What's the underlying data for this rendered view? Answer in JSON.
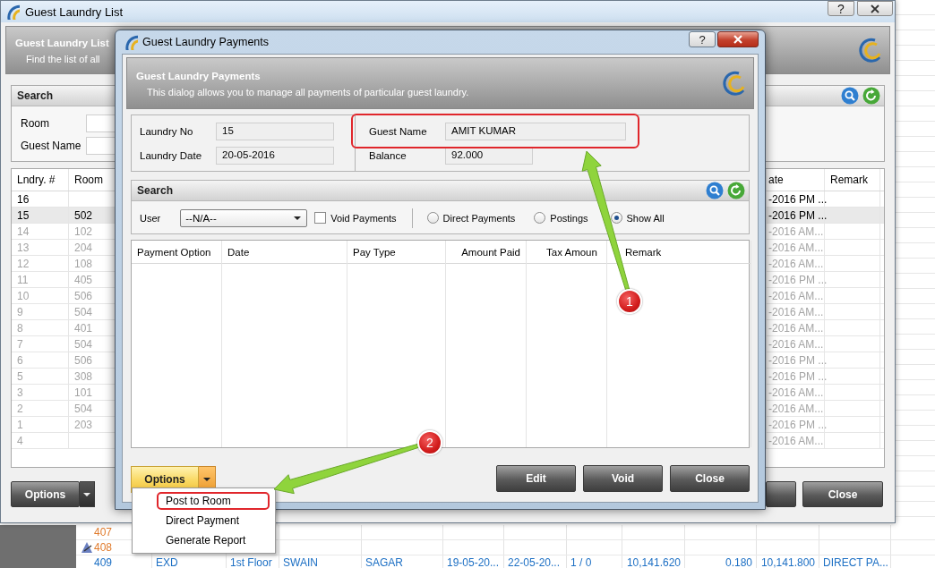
{
  "background_grid": {
    "rows": [
      {
        "cells": [
          "407"
        ],
        "color": "#e07b2c",
        "marked": false
      },
      {
        "cells": [
          "408"
        ],
        "color": "#e07b2c",
        "marked": true
      },
      {
        "cells": [
          "409",
          "EXD",
          "1st Floor",
          "SWAIN",
          "SAGAR",
          "19-05-20...",
          "22-05-20...",
          "1 / 0",
          "10,141.620",
          "0.180",
          "10,141.800",
          "DIRECT PA..."
        ],
        "color": "#1c6fc4",
        "marked": false
      }
    ]
  },
  "list_window": {
    "title": "Guest Laundry List",
    "help_button": "?",
    "header": {
      "title": "Guest Laundry List",
      "subtitle": "Find the list of all"
    },
    "search": {
      "title": "Search",
      "fields": [
        {
          "label": "Room"
        },
        {
          "label": "Guest Name"
        }
      ]
    },
    "table": {
      "columns": [
        "Lndry. #",
        "Room",
        "ate",
        "Remark"
      ],
      "rows": [
        {
          "cells": [
            "16",
            "",
            "-2016 PM ...",
            ""
          ],
          "selected": false,
          "dimmed": false
        },
        {
          "cells": [
            "15",
            "502",
            "-2016 PM ...",
            ""
          ],
          "selected": true,
          "dimmed": false
        },
        {
          "cells": [
            "14",
            "102",
            "-2016 AM...",
            ""
          ],
          "selected": false,
          "dimmed": true
        },
        {
          "cells": [
            "13",
            "204",
            "-2016 AM...",
            ""
          ],
          "selected": false,
          "dimmed": true
        },
        {
          "cells": [
            "12",
            "108",
            "-2016 AM...",
            ""
          ],
          "selected": false,
          "dimmed": true
        },
        {
          "cells": [
            "11",
            "405",
            "-2016 PM ...",
            ""
          ],
          "selected": false,
          "dimmed": true
        },
        {
          "cells": [
            "10",
            "506",
            "-2016 AM...",
            ""
          ],
          "selected": false,
          "dimmed": true
        },
        {
          "cells": [
            "9",
            "504",
            "-2016 AM...",
            ""
          ],
          "selected": false,
          "dimmed": true
        },
        {
          "cells": [
            "8",
            "401",
            "-2016 AM...",
            ""
          ],
          "selected": false,
          "dimmed": true
        },
        {
          "cells": [
            "7",
            "504",
            "-2016 AM...",
            ""
          ],
          "selected": false,
          "dimmed": true
        },
        {
          "cells": [
            "6",
            "506",
            "-2016 PM ...",
            ""
          ],
          "selected": false,
          "dimmed": true
        },
        {
          "cells": [
            "5",
            "308",
            "-2016 PM ...",
            ""
          ],
          "selected": false,
          "dimmed": true
        },
        {
          "cells": [
            "3",
            "101",
            "-2016 AM...",
            ""
          ],
          "selected": false,
          "dimmed": true
        },
        {
          "cells": [
            "2",
            "504",
            "-2016 AM...",
            ""
          ],
          "selected": false,
          "dimmed": true
        },
        {
          "cells": [
            "1",
            "203",
            "-2016 PM ...",
            ""
          ],
          "selected": false,
          "dimmed": true
        },
        {
          "cells": [
            "4",
            "",
            "-2016 AM...",
            ""
          ],
          "selected": false,
          "dimmed": true
        }
      ]
    },
    "buttons": [
      {
        "label": "Options",
        "kind": "split"
      },
      {
        "label": "Close",
        "kind": "plain"
      }
    ]
  },
  "dialog": {
    "title": "Guest Laundry Payments",
    "help_button": "?",
    "header": {
      "title": "Guest Laundry Payments",
      "subtitle": "This dialog allows you to manage all payments of particular guest laundry."
    },
    "info": [
      {
        "label": "Laundry No",
        "value": "15"
      },
      {
        "label": "Laundry Date",
        "value": "20-05-2016"
      },
      {
        "label": "Guest Name",
        "value": "AMIT KUMAR"
      },
      {
        "label": "Balance",
        "value": "92.000"
      }
    ],
    "search": {
      "title": "Search",
      "user_label": "User",
      "user_value": "--N/A--",
      "void_payments": {
        "label": "Void Payments",
        "checked": false
      },
      "filters": [
        {
          "label": "Direct Payments",
          "selected": false
        },
        {
          "label": "Postings",
          "selected": false
        },
        {
          "label": "Show All",
          "selected": true
        }
      ]
    },
    "table": {
      "columns": [
        "Payment Option",
        "Date",
        "Pay Type",
        "Amount Paid",
        "Tax Amoun",
        "Remark"
      ]
    },
    "options_button": "Options",
    "menu": [
      {
        "label": "Post to Room",
        "highlighted": true
      },
      {
        "label": "Direct Payment",
        "highlighted": false
      },
      {
        "label": "Generate Report",
        "highlighted": false
      }
    ],
    "buttons": [
      "Edit",
      "Void",
      "Close"
    ]
  },
  "callouts": [
    {
      "label": "1"
    },
    {
      "label": "2"
    }
  ]
}
